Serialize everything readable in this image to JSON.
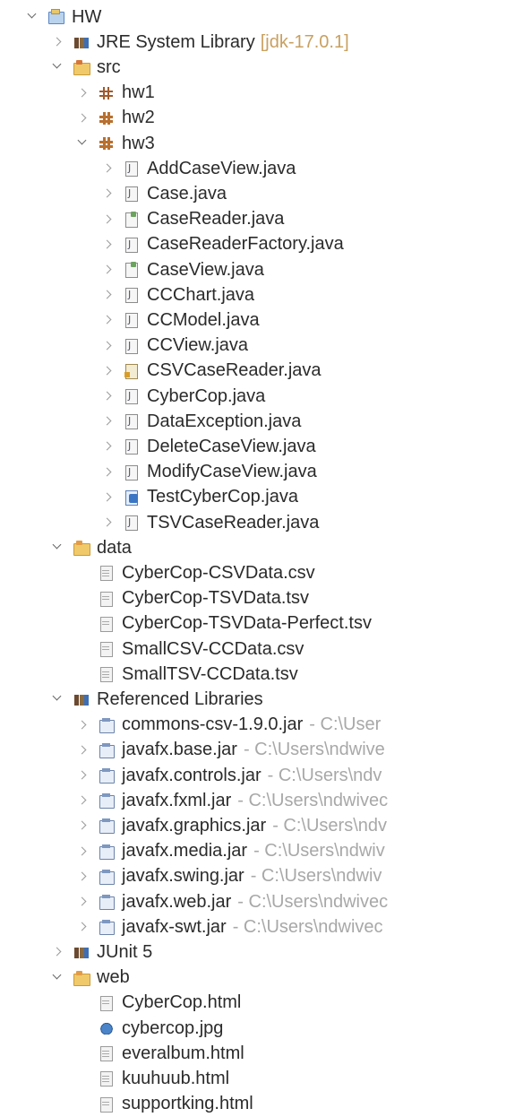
{
  "tree": {
    "nodes": [
      {
        "label": "HW",
        "depth": 0,
        "toggle": "expanded",
        "icon": "project-icon",
        "deco": ""
      },
      {
        "label": "JRE System Library",
        "depth": 1,
        "toggle": "collapsed",
        "icon": "library-icon",
        "deco": "[jdk-17.0.1]"
      },
      {
        "label": "src",
        "depth": 1,
        "toggle": "expanded",
        "icon": "source-folder-icon",
        "deco": ""
      },
      {
        "label": "hw1",
        "depth": 2,
        "toggle": "collapsed",
        "icon": "package-icon",
        "deco": ""
      },
      {
        "label": "hw2",
        "depth": 2,
        "toggle": "collapsed",
        "icon": "package-filled-icon",
        "deco": ""
      },
      {
        "label": "hw3",
        "depth": 2,
        "toggle": "expanded",
        "icon": "package-filled-icon",
        "deco": ""
      },
      {
        "label": "AddCaseView.java",
        "depth": 3,
        "toggle": "collapsed",
        "icon": "java-file-icon",
        "deco": ""
      },
      {
        "label": "Case.java",
        "depth": 3,
        "toggle": "collapsed",
        "icon": "java-file-icon",
        "deco": ""
      },
      {
        "label": "CaseReader.java",
        "depth": 3,
        "toggle": "collapsed",
        "icon": "java-file-modified-icon",
        "deco": ""
      },
      {
        "label": "CaseReaderFactory.java",
        "depth": 3,
        "toggle": "collapsed",
        "icon": "java-file-icon",
        "deco": ""
      },
      {
        "label": "CaseView.java",
        "depth": 3,
        "toggle": "collapsed",
        "icon": "java-file-modified-icon",
        "deco": ""
      },
      {
        "label": "CCChart.java",
        "depth": 3,
        "toggle": "collapsed",
        "icon": "java-file-icon",
        "deco": ""
      },
      {
        "label": "CCModel.java",
        "depth": 3,
        "toggle": "collapsed",
        "icon": "java-file-icon",
        "deco": ""
      },
      {
        "label": "CCView.java",
        "depth": 3,
        "toggle": "collapsed",
        "icon": "java-file-icon",
        "deco": ""
      },
      {
        "label": "CSVCaseReader.java",
        "depth": 3,
        "toggle": "collapsed",
        "icon": "java-file-warning-icon",
        "deco": ""
      },
      {
        "label": "CyberCop.java",
        "depth": 3,
        "toggle": "collapsed",
        "icon": "java-file-icon",
        "deco": ""
      },
      {
        "label": "DataException.java",
        "depth": 3,
        "toggle": "collapsed",
        "icon": "java-file-icon",
        "deco": ""
      },
      {
        "label": "DeleteCaseView.java",
        "depth": 3,
        "toggle": "collapsed",
        "icon": "java-file-icon",
        "deco": ""
      },
      {
        "label": "ModifyCaseView.java",
        "depth": 3,
        "toggle": "collapsed",
        "icon": "java-file-icon",
        "deco": ""
      },
      {
        "label": "TestCyberCop.java",
        "depth": 3,
        "toggle": "collapsed",
        "icon": "test-file-icon",
        "deco": ""
      },
      {
        "label": "TSVCaseReader.java",
        "depth": 3,
        "toggle": "collapsed",
        "icon": "java-file-icon",
        "deco": ""
      },
      {
        "label": "data",
        "depth": 1,
        "toggle": "expanded",
        "icon": "folder-icon",
        "deco": ""
      },
      {
        "label": "CyberCop-CSVData.csv",
        "depth": 2,
        "toggle": "none",
        "icon": "file-icon",
        "deco": ""
      },
      {
        "label": "CyberCop-TSVData.tsv",
        "depth": 2,
        "toggle": "none",
        "icon": "file-icon",
        "deco": ""
      },
      {
        "label": "CyberCop-TSVData-Perfect.tsv",
        "depth": 2,
        "toggle": "none",
        "icon": "file-icon",
        "deco": ""
      },
      {
        "label": "SmallCSV-CCData.csv",
        "depth": 2,
        "toggle": "none",
        "icon": "file-icon",
        "deco": ""
      },
      {
        "label": "SmallTSV-CCData.tsv",
        "depth": 2,
        "toggle": "none",
        "icon": "file-icon",
        "deco": ""
      },
      {
        "label": "Referenced Libraries",
        "depth": 1,
        "toggle": "expanded",
        "icon": "library-icon",
        "deco": ""
      },
      {
        "label": "commons-csv-1.9.0.jar",
        "depth": 2,
        "toggle": "collapsed",
        "icon": "jar-icon",
        "deco": "- C:\\User"
      },
      {
        "label": "javafx.base.jar",
        "depth": 2,
        "toggle": "collapsed",
        "icon": "jar-icon",
        "deco": "- C:\\Users\\ndwive"
      },
      {
        "label": "javafx.controls.jar",
        "depth": 2,
        "toggle": "collapsed",
        "icon": "jar-icon",
        "deco": "- C:\\Users\\ndv"
      },
      {
        "label": "javafx.fxml.jar",
        "depth": 2,
        "toggle": "collapsed",
        "icon": "jar-icon",
        "deco": "- C:\\Users\\ndwivec"
      },
      {
        "label": "javafx.graphics.jar",
        "depth": 2,
        "toggle": "collapsed",
        "icon": "jar-icon",
        "deco": "- C:\\Users\\ndv"
      },
      {
        "label": "javafx.media.jar",
        "depth": 2,
        "toggle": "collapsed",
        "icon": "jar-icon",
        "deco": "- C:\\Users\\ndwiv"
      },
      {
        "label": "javafx.swing.jar",
        "depth": 2,
        "toggle": "collapsed",
        "icon": "jar-icon",
        "deco": "- C:\\Users\\ndwiv"
      },
      {
        "label": "javafx.web.jar",
        "depth": 2,
        "toggle": "collapsed",
        "icon": "jar-icon",
        "deco": "- C:\\Users\\ndwivec"
      },
      {
        "label": "javafx-swt.jar",
        "depth": 2,
        "toggle": "collapsed",
        "icon": "jar-icon",
        "deco": "- C:\\Users\\ndwivec"
      },
      {
        "label": "JUnit 5",
        "depth": 1,
        "toggle": "collapsed",
        "icon": "library-icon",
        "deco": ""
      },
      {
        "label": "web",
        "depth": 1,
        "toggle": "expanded",
        "icon": "folder-icon",
        "deco": ""
      },
      {
        "label": "CyberCop.html",
        "depth": 2,
        "toggle": "none",
        "icon": "file-icon",
        "deco": ""
      },
      {
        "label": "cybercop.jpg",
        "depth": 2,
        "toggle": "none",
        "icon": "image-icon",
        "deco": ""
      },
      {
        "label": "everalbum.html",
        "depth": 2,
        "toggle": "none",
        "icon": "file-icon",
        "deco": ""
      },
      {
        "label": "kuuhuub.html",
        "depth": 2,
        "toggle": "none",
        "icon": "file-icon",
        "deco": ""
      },
      {
        "label": "supportking.html",
        "depth": 2,
        "toggle": "none",
        "icon": "file-icon",
        "deco": ""
      }
    ]
  }
}
